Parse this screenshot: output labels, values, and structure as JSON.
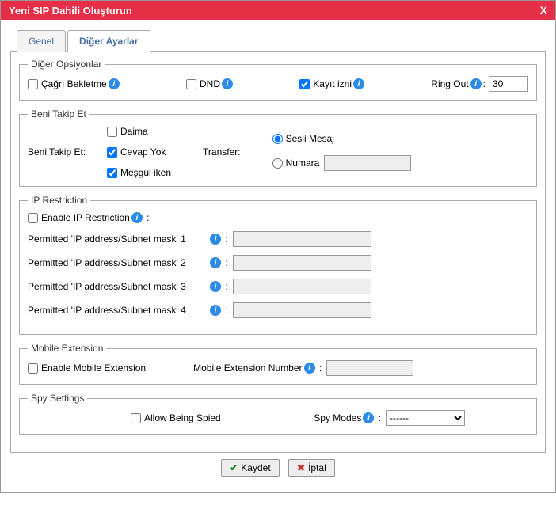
{
  "window": {
    "title": "Yeni SIP Dahili Oluşturun",
    "close": "X"
  },
  "tabs": {
    "general": "Genel",
    "other": "Diğer Ayarlar"
  },
  "diger": {
    "legend": "Diğer Opsiyonlar",
    "callwaiting": "Çağrı Bekletme",
    "dnd": "DND",
    "record": "Kayıt izni",
    "ringout": "Ring Out",
    "ringout_value": "30"
  },
  "followme": {
    "legend": "Beni Takip Et",
    "left_label": "Beni Takip Et:",
    "always": "Daima",
    "noanswer": "Cevap Yok",
    "busy": "Meşgul iken",
    "transfer": "Transfer:",
    "voicemail": "Sesli Mesaj",
    "number": "Numara",
    "number_value": ""
  },
  "ip": {
    "legend": "IP Restriction",
    "enable": "Enable IP Restriction",
    "rows": [
      {
        "label": "Permitted 'IP address/Subnet mask'  1",
        "value": ""
      },
      {
        "label": "Permitted 'IP address/Subnet mask'  2",
        "value": ""
      },
      {
        "label": "Permitted 'IP address/Subnet mask'  3",
        "value": ""
      },
      {
        "label": "Permitted 'IP address/Subnet mask'  4",
        "value": ""
      }
    ]
  },
  "mobile": {
    "legend": "Mobile Extension",
    "enable": "Enable Mobile Extension",
    "number_label": "Mobile Extension Number",
    "number_value": ""
  },
  "spy": {
    "legend": "Spy Settings",
    "allow": "Allow Being Spied",
    "modes_label": "Spy Modes",
    "selected": "------"
  },
  "footer": {
    "save": "Kaydet",
    "cancel": "İptal"
  },
  "glyph": {
    "info": "i",
    "tick": "✔",
    "cross": "✖"
  }
}
